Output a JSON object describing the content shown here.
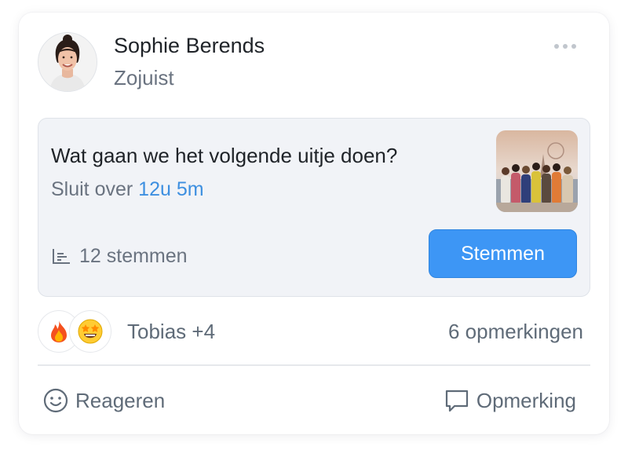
{
  "post": {
    "author": "Sophie Berends",
    "time": "Zojuist"
  },
  "poll": {
    "question": "Wat gaan we het volgende uitje doen?",
    "closes_prefix": "Sluit over",
    "closes_time": "12u 5m",
    "votes_label": "12 stemmen",
    "vote_button": "Stemmen"
  },
  "reactions": {
    "emojis": [
      "fire",
      "star-struck"
    ],
    "reactors": "Tobias +4",
    "comments": "6 opmerkingen"
  },
  "actions": {
    "react": "Reageren",
    "comment": "Opmerking"
  },
  "icons": {
    "more": "more-horizontal-icon",
    "votes": "bar-chart-icon",
    "react": "smiley-icon",
    "comment": "comment-icon"
  },
  "colors": {
    "accent": "#3d96f5",
    "closes_time": "#3d8fe0",
    "poll_bg": "#f1f3f7"
  }
}
